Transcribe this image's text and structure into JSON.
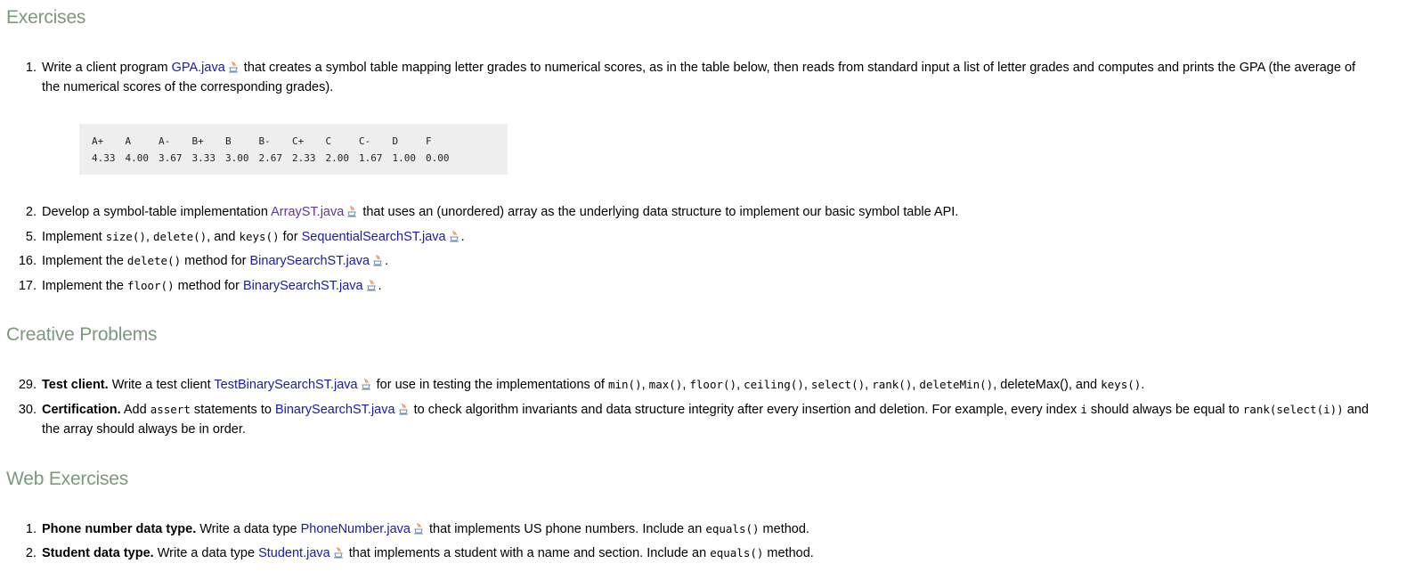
{
  "sections": {
    "exercises": "Exercises",
    "creative": "Creative Problems",
    "web": "Web Exercises"
  },
  "ex1": {
    "num": "1.",
    "t1": "Write a client program ",
    "link": "GPA.java",
    "t2": " that creates a symbol table mapping letter grades to numerical scores, as in the table below, then reads from standard input a list of letter grades and computes and prints the GPA (the average of",
    "t3": "the numerical scores of the corresponding grades)."
  },
  "grades": {
    "letters": [
      "A+",
      "A",
      "A-",
      "B+",
      "B",
      "B-",
      "C+",
      "C",
      "C-",
      "D",
      "F"
    ],
    "scores": [
      "4.33",
      "4.00",
      "3.67",
      "3.33",
      "3.00",
      "2.67",
      "2.33",
      "2.00",
      "1.67",
      "1.00",
      "0.00"
    ]
  },
  "ex2": {
    "num": "2.",
    "t1": "Develop a symbol-table implementation ",
    "link": "ArrayST.java",
    "t2": " that uses an (unordered) array as the underlying data structure to implement our basic symbol table API."
  },
  "ex5": {
    "num": "5.",
    "t1": "Implement ",
    "c1": "size()",
    "t2": ", ",
    "c2": "delete()",
    "t3": ", and ",
    "c3": "keys()",
    "t4": " for ",
    "link": "SequentialSearchST.java",
    "t5": "."
  },
  "ex16": {
    "num": "16.",
    "t1": "Implement the ",
    "c1": "delete()",
    "t2": " method for ",
    "link": "BinarySearchST.java",
    "t3": "."
  },
  "ex17": {
    "num": "17.",
    "t1": "Implement the ",
    "c1": "floor()",
    "t2": " method for ",
    "link": "BinarySearchST.java",
    "t3": "."
  },
  "cp29": {
    "num": "29.",
    "bold": "Test client.",
    "t1": " Write a test client ",
    "link": "TestBinarySearchST.java",
    "t2": " for use in testing the implementations of ",
    "c1": "min()",
    "s1": ", ",
    "c2": "max()",
    "s2": ", ",
    "c3": "floor()",
    "s3": ", ",
    "c4": "ceiling()",
    "s4": ", ",
    "c5": "select()",
    "s5": ", ",
    "c6": "rank()",
    "s6": ", ",
    "c7": "deleteMin()",
    "t3": ", deleteMax(), and ",
    "c8": "keys()",
    "t4": "."
  },
  "cp30": {
    "num": "30.",
    "bold": "Certification.",
    "t1": " Add ",
    "c1": "assert",
    "t2": " statements to ",
    "link": "BinarySearchST.java",
    "t3": " to check algorithm invariants and data structure integrity after every insertion and deletion. For example, every index ",
    "c2": "i",
    "t4": " should always be equal to ",
    "c3": "rank(select(i))",
    "t5": " and",
    "t6": "the array should always be in order."
  },
  "we1": {
    "num": "1.",
    "bold": "Phone number data type.",
    "t1": " Write a data type ",
    "link": "PhoneNumber.java",
    "t2": " that implements US phone numbers. Include an ",
    "c1": "equals()",
    "t3": " method."
  },
  "we2": {
    "num": "2.",
    "bold": "Student data type.",
    "t1": " Write a data type ",
    "link": "Student.java",
    "t2": " that implements a student with a name and section. Include an ",
    "c1": "equals()",
    "t3": " method."
  },
  "icons": {
    "java_file": "java-cup-icon"
  }
}
